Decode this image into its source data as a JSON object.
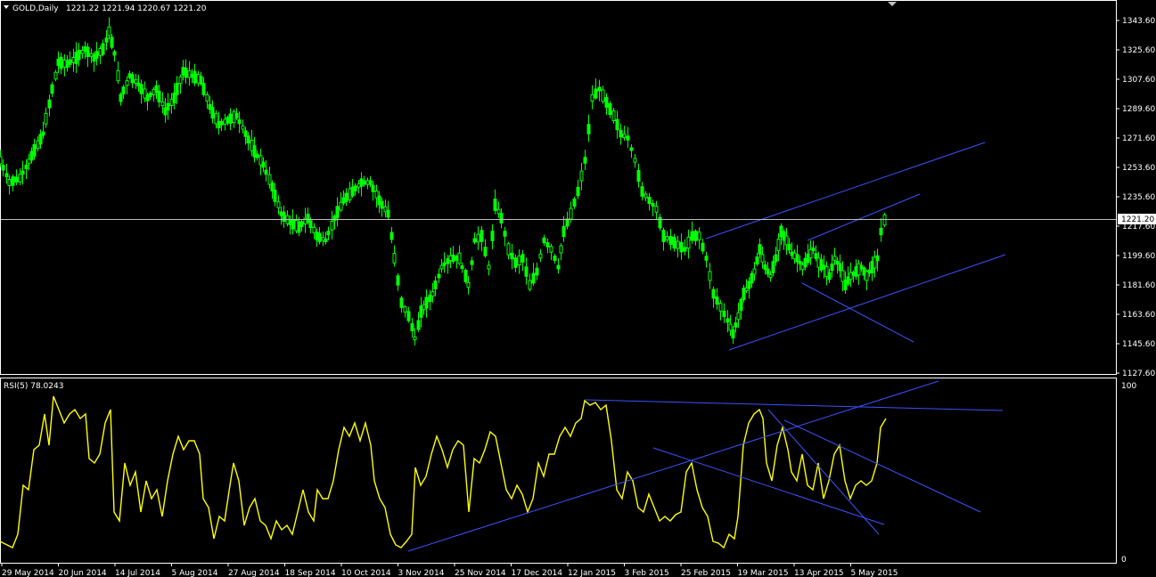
{
  "header": {
    "symbol_label": "GOLD,Daily",
    "ohlc": "1221.22 1221.94 1220.67 1221.20"
  },
  "rsi_header": "RSI(5) 78.0243",
  "price_axis": {
    "ticks": [
      "1343.60",
      "1325.60",
      "1307.60",
      "1289.60",
      "1271.60",
      "1253.60",
      "1235.60",
      "1217.60",
      "1199.60",
      "1181.60",
      "1163.60",
      "1145.60",
      "1127.60"
    ],
    "current_price_label": "1221.20"
  },
  "rsi_axis": {
    "ticks": [
      "100",
      "0"
    ]
  },
  "dates": [
    "29 May 2014",
    "20 Jun 2014",
    "14 Jul 2014",
    "5 Aug 2014",
    "27 Aug 2014",
    "18 Sep 2014",
    "10 Oct 2014",
    "3 Nov 2014",
    "25 Nov 2014",
    "17 Dec 2014",
    "12 Jan 2015",
    "3 Feb 2015",
    "25 Feb 2015",
    "19 Mar 2015",
    "13 Apr 2015",
    "5 May 2015"
  ],
  "colors": {
    "background": "#000000",
    "candle": "#00ff00",
    "rsi": "#ffff00",
    "trendline": "#3a52ff",
    "axis": "#ffffff",
    "current_price_line": "#c0c0c0"
  },
  "chart_data": [
    {
      "type": "line",
      "title": "GOLD,Daily",
      "note_series": "daily close (approximate)",
      "x": [
        "29 May 2014",
        "20 Jun 2014",
        "14 Jul 2014",
        "5 Aug 2014",
        "27 Aug 2014",
        "18 Sep 2014",
        "10 Oct 2014",
        "3 Nov 2014",
        "25 Nov 2014",
        "17 Dec 2014",
        "12 Jan 2015",
        "3 Feb 2015",
        "25 Feb 2015",
        "19 Mar 2015",
        "13 Apr 2015",
        "5 May 2015",
        "15 May 2015"
      ],
      "series": [
        {
          "values": [
            1255,
            1318,
            1325,
            1305,
            1280,
            1225,
            1235,
            1168,
            1196,
            1192,
            1232,
            1270,
            1212,
            1180,
            1203,
            1185,
            1221.2
          ]
        }
      ],
      "ylim": [
        1127.6,
        1343.6
      ]
    },
    {
      "type": "line",
      "title": "RSI(5) 78.0243",
      "x": [
        "29 May 2014",
        "20 Jun 2014",
        "14 Jul 2014",
        "5 Aug 2014",
        "27 Aug 2014",
        "18 Sep 2014",
        "10 Oct 2014",
        "3 Nov 2014",
        "25 Nov 2014",
        "17 Dec 2014",
        "12 Jan 2015",
        "3 Feb 2015",
        "25 Feb 2015",
        "19 Mar 2015",
        "13 Apr 2015",
        "5 May 2015",
        "15 May 2015"
      ],
      "series": [
        {
          "values": [
            10,
            88,
            85,
            35,
            20,
            25,
            75,
            8,
            65,
            30,
            88,
            30,
            10,
            82,
            35,
            40,
            78.0243
          ]
        }
      ],
      "ylim": [
        0,
        100
      ]
    }
  ]
}
